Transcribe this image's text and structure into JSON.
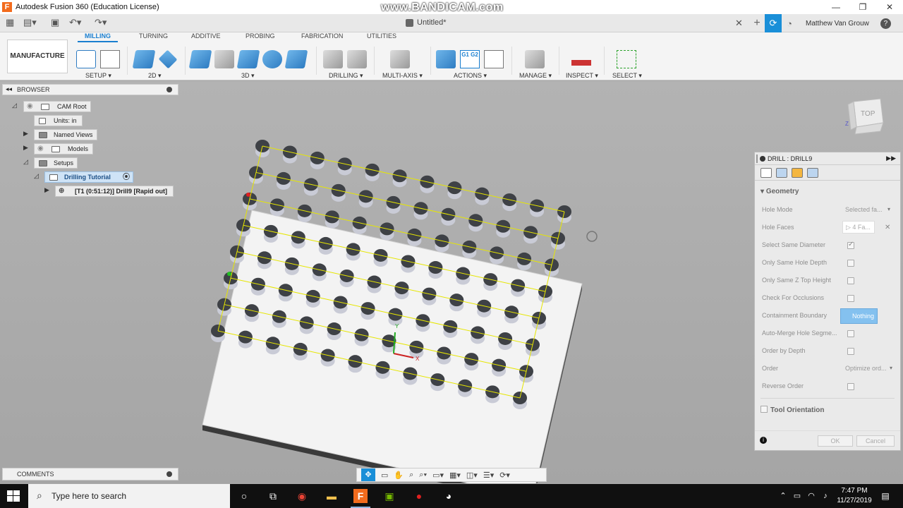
{
  "window": {
    "title": "Autodesk Fusion 360 (Education License)",
    "watermark": "www.BANDICAM.com",
    "app_icon_letter": "F"
  },
  "tabbar": {
    "document_name": "Untitled*",
    "user_name": "Matthew Van Grouw"
  },
  "ribbon": {
    "tabs": [
      "MILLING",
      "TURNING",
      "ADDITIVE",
      "PROBING",
      "FABRICATION",
      "UTILITIES"
    ],
    "active_tab": "MILLING",
    "workspace": "MANUFACTURE ▾",
    "groups": {
      "setup": "SETUP ▾",
      "twod": "2D ▾",
      "threed": "3D ▾",
      "drilling": "DRILLING ▾",
      "multiaxis": "MULTI-AXIS ▾",
      "actions": "ACTIONS ▾",
      "manage": "MANAGE ▾",
      "inspect": "INSPECT ▾",
      "select": "SELECT ▾"
    },
    "actions_label": "G1 G2"
  },
  "browser": {
    "title": "BROWSER",
    "nodes": {
      "cam_root": "CAM Root",
      "units": "Units: in",
      "named_views": "Named Views",
      "models": "Models",
      "setups": "Setups",
      "setup_name": "Drilling Tutorial",
      "operation": "[T1 (0:51:12)] Drill9 [Rapid out]"
    }
  },
  "viewcube": {
    "label": "TOP"
  },
  "drill_panel": {
    "title": "DRILL : DRILL9",
    "section_geometry": "Geometry",
    "rows": {
      "hole_mode": "Hole Mode",
      "hole_mode_value": "Selected fa...",
      "hole_faces": "Hole Faces",
      "hole_faces_value": "4 Fa...",
      "select_same_diameter": "Select Same Diameter",
      "only_same_hole_depth": "Only Same Hole Depth",
      "only_same_z_top": "Only Same Z Top Height",
      "check_occlusions": "Check For Occlusions",
      "containment_boundary": "Containment Boundary",
      "containment_value": "Nothing",
      "auto_merge": "Auto-Merge Hole Segme...",
      "order_by_depth": "Order by Depth",
      "order": "Order",
      "order_value": "Optimize ord...",
      "reverse_order": "Reverse Order"
    },
    "section_tool_orientation": "Tool Orientation",
    "ok": "OK",
    "cancel": "Cancel"
  },
  "comments": {
    "title": "COMMENTS"
  },
  "taskbar": {
    "search_placeholder": "Type here to search",
    "time": "7:47 PM",
    "date": "11/27/2019"
  },
  "model": {
    "rows": 8,
    "cols": 12
  },
  "colors": {
    "accent": "#1a7fd0",
    "hole": "#3e4146",
    "toolpath": "#e6e600"
  }
}
